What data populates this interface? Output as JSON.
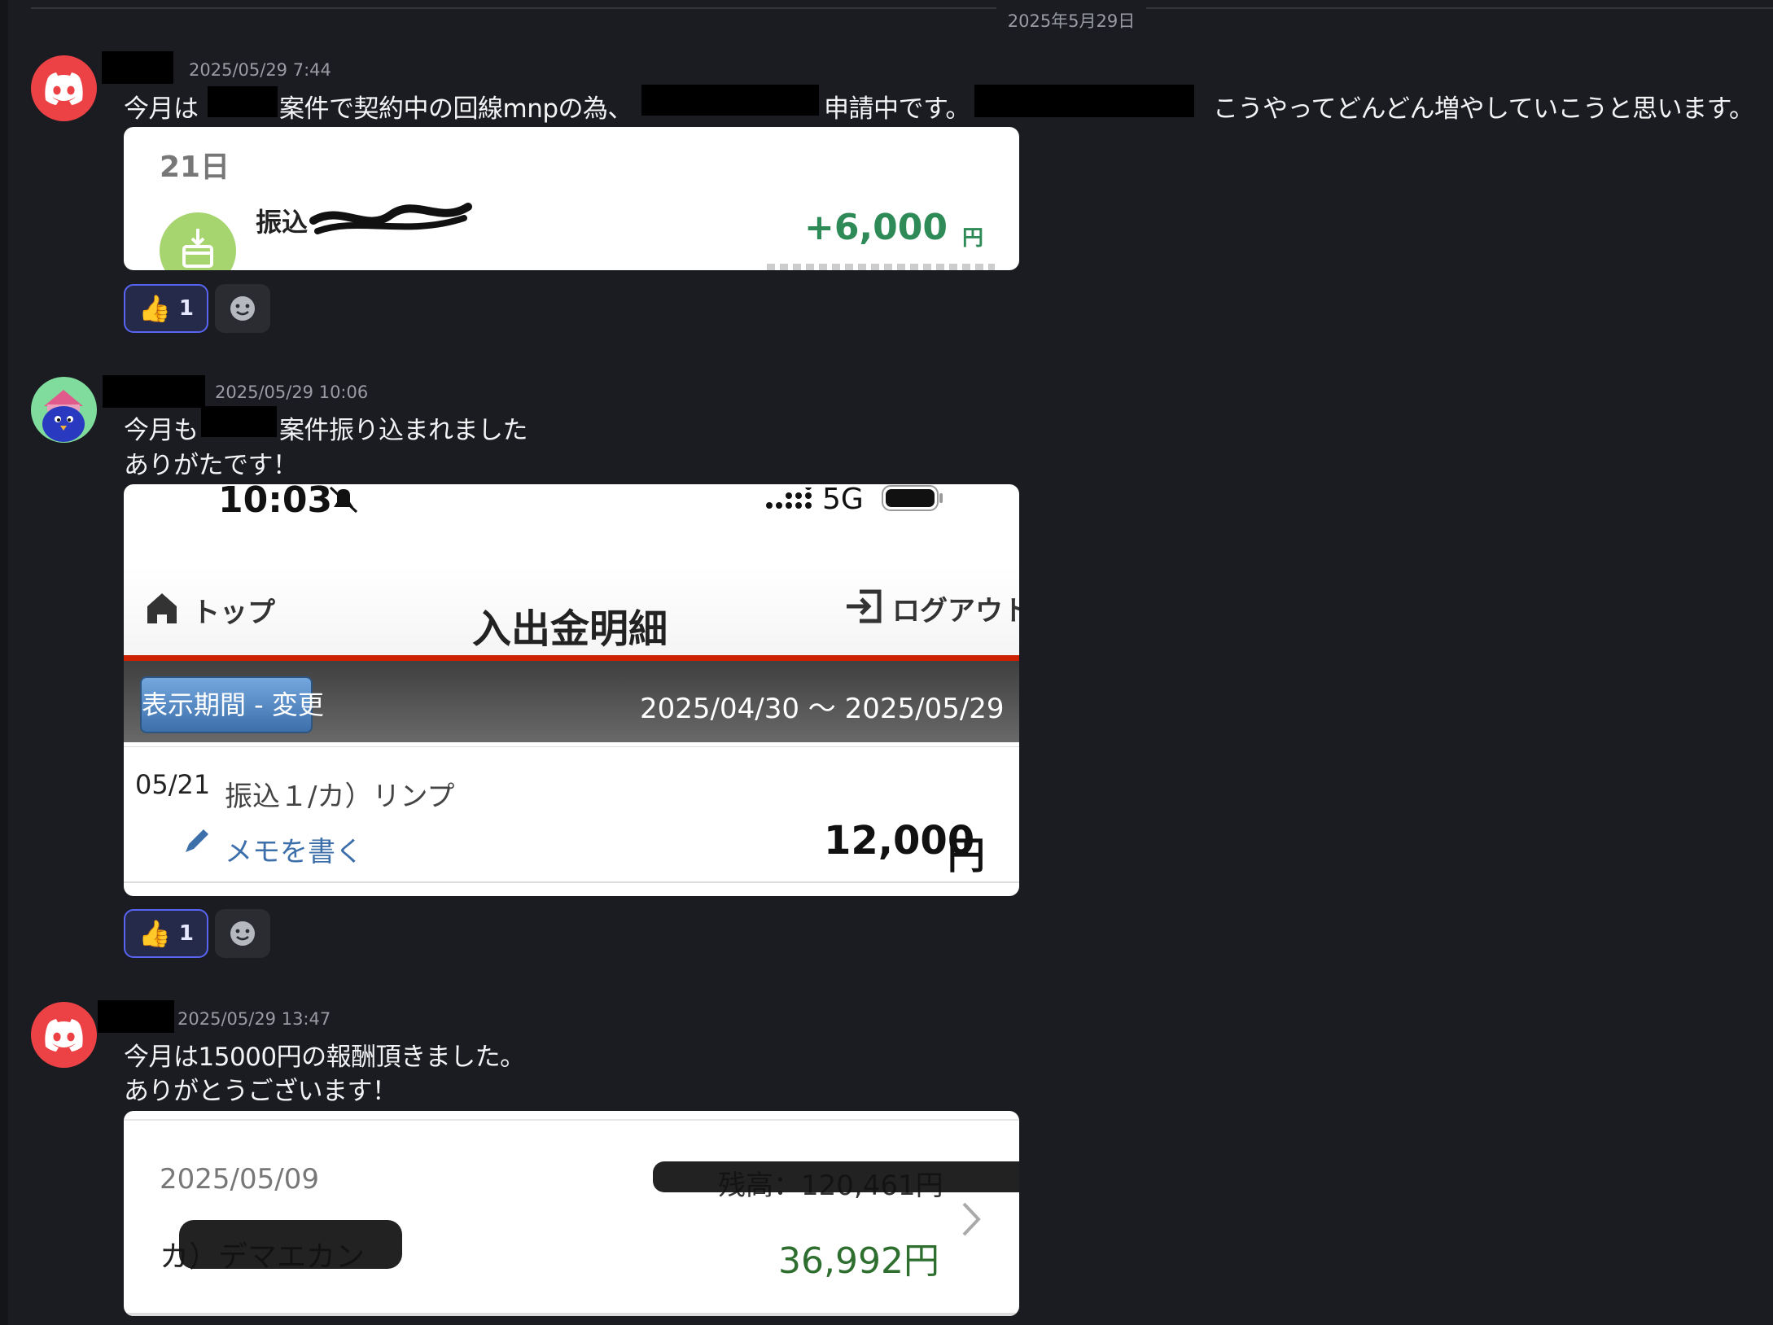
{
  "date_divider": "2025年5月29日",
  "messages": [
    {
      "timestamp": "2025/05/29 7:44",
      "text_parts": [
        "今月は",
        "案件で契約中の回線mnpの為、",
        "申請中です。",
        "こうやってどんどん増やしていこうと思います。"
      ],
      "attachment": {
        "day": "21日",
        "label": "振込",
        "amount": "+6,000",
        "unit": "円"
      },
      "reaction": {
        "emoji": "👍",
        "count": "1"
      }
    },
    {
      "timestamp": "2025/05/29 10:06",
      "text_parts": [
        "今月も",
        "案件振り込まれました"
      ],
      "text_line2": "ありがたです！",
      "attachment": {
        "time": "10:03",
        "network": "5G",
        "nav_home": "トップ",
        "title": "入出金明細",
        "logout": "ログアウト",
        "period_button": "表示期間 - 変更",
        "period": "2025/04/30 ～ 2025/05/29",
        "date": "05/21",
        "description": "振込１/カ）リンプ",
        "memo": "メモを書く",
        "amount": "12,000",
        "unit": "円"
      },
      "reaction": {
        "emoji": "👍",
        "count": "1"
      }
    },
    {
      "timestamp": "2025/05/29 13:47",
      "text_line1": "今月は15000円の報酬頂きました。",
      "text_line2": "ありがとうございます！",
      "attachment": {
        "date": "2025/05/09",
        "balance": "残高：120,461円",
        "payee": "カ）デマエカン",
        "amount": "36,992円"
      }
    }
  ],
  "colors": {
    "background": "#1b1c21",
    "discord_red": "#ed4245",
    "reaction_border": "#5865f2",
    "money_green": "#2e8b57",
    "bank_red": "#cc2200"
  },
  "icons": [
    "discord-logo-icon",
    "thumbs-up-icon",
    "add-reaction-icon",
    "download-icon",
    "home-icon",
    "logout-icon",
    "pencil-icon",
    "bell-slash-icon",
    "signal-icon",
    "battery-icon",
    "chevron-right-icon"
  ]
}
